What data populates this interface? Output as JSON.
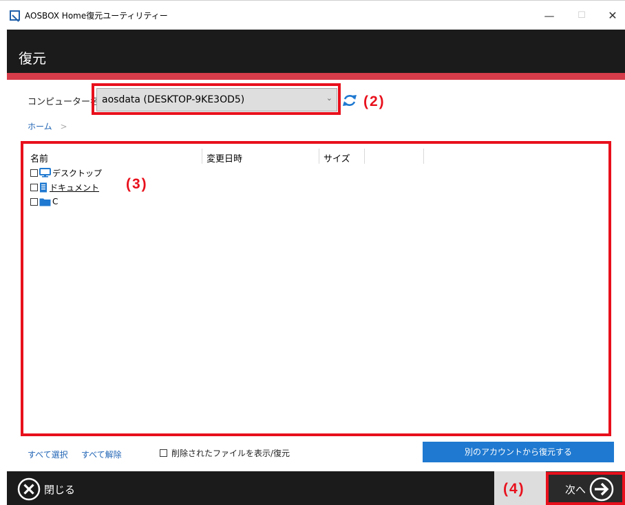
{
  "window": {
    "title": "AOSBOX Home復元ユーティリティー",
    "min_glyph": "—",
    "max_glyph": "☐",
    "close_glyph": "✕"
  },
  "header": {
    "title": "復元"
  },
  "computer": {
    "label": "コンピューター名:",
    "selected": "aosdata (DESKTOP-9KE3OD5)",
    "chevron": "⌄"
  },
  "breadcrumb": {
    "home": "ホーム",
    "separator": ">"
  },
  "file_list": {
    "columns": [
      "名前",
      "変更日時",
      "サイズ"
    ],
    "items": [
      {
        "name": "デスクトップ",
        "icon": "desktop-monitor-icon"
      },
      {
        "name": "ドキュメント",
        "icon": "document-icon"
      },
      {
        "name": "C",
        "icon": "folder-icon"
      }
    ]
  },
  "bottom": {
    "select_all": "すべて選択",
    "deselect_all": "すべて解除",
    "show_deleted": "削除されたファイルを表示/復元",
    "restore_other_account": "別のアカウントから復元する"
  },
  "footer": {
    "close": "閉じる",
    "next": "次へ"
  },
  "annotations": {
    "a2": "(2)",
    "a3": "(3)",
    "a4": "(4)"
  },
  "colors": {
    "accent_red": "#d63c49",
    "annotation_red": "#e8101c",
    "link_blue": "#1f63b4",
    "button_blue": "#1f79d0",
    "dark_bar": "#1b1b1b"
  }
}
